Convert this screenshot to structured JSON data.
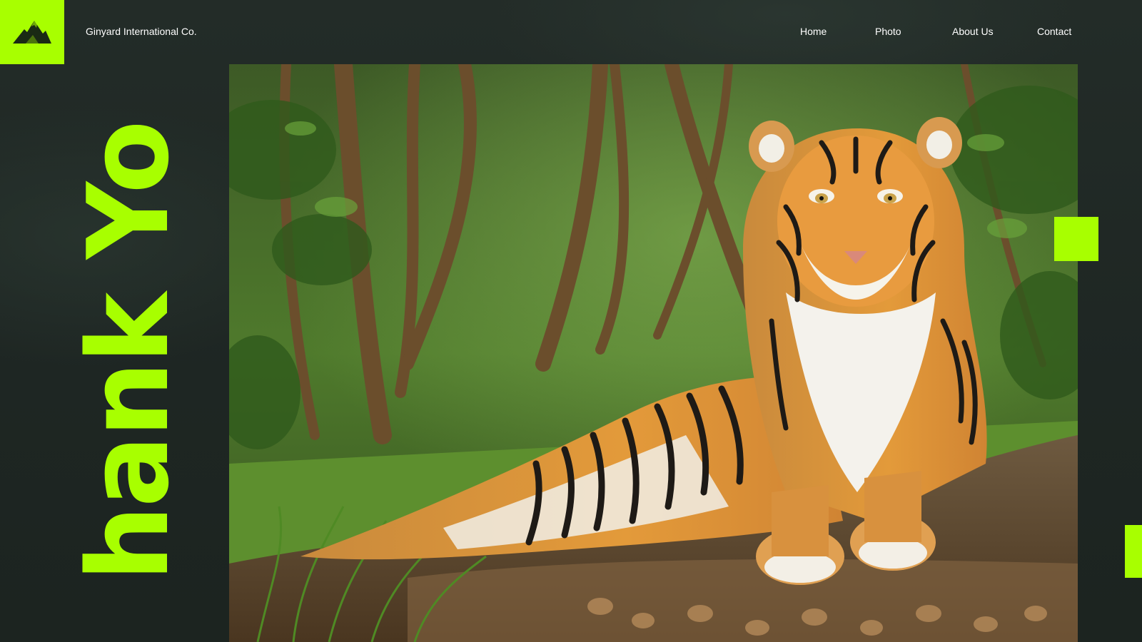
{
  "brand": {
    "name": "Ginyard International Co.",
    "logo_icon": "mountain-icon"
  },
  "nav": {
    "items": [
      {
        "label": "Home"
      },
      {
        "label": "Photo"
      },
      {
        "label": "About Us"
      },
      {
        "label": "Contact"
      }
    ]
  },
  "hero": {
    "headline": "Thank You",
    "image_icon": "tiger-photo"
  },
  "colors": {
    "accent": "#a8ff00",
    "background": "#1f2824",
    "text": "#ffffff"
  }
}
